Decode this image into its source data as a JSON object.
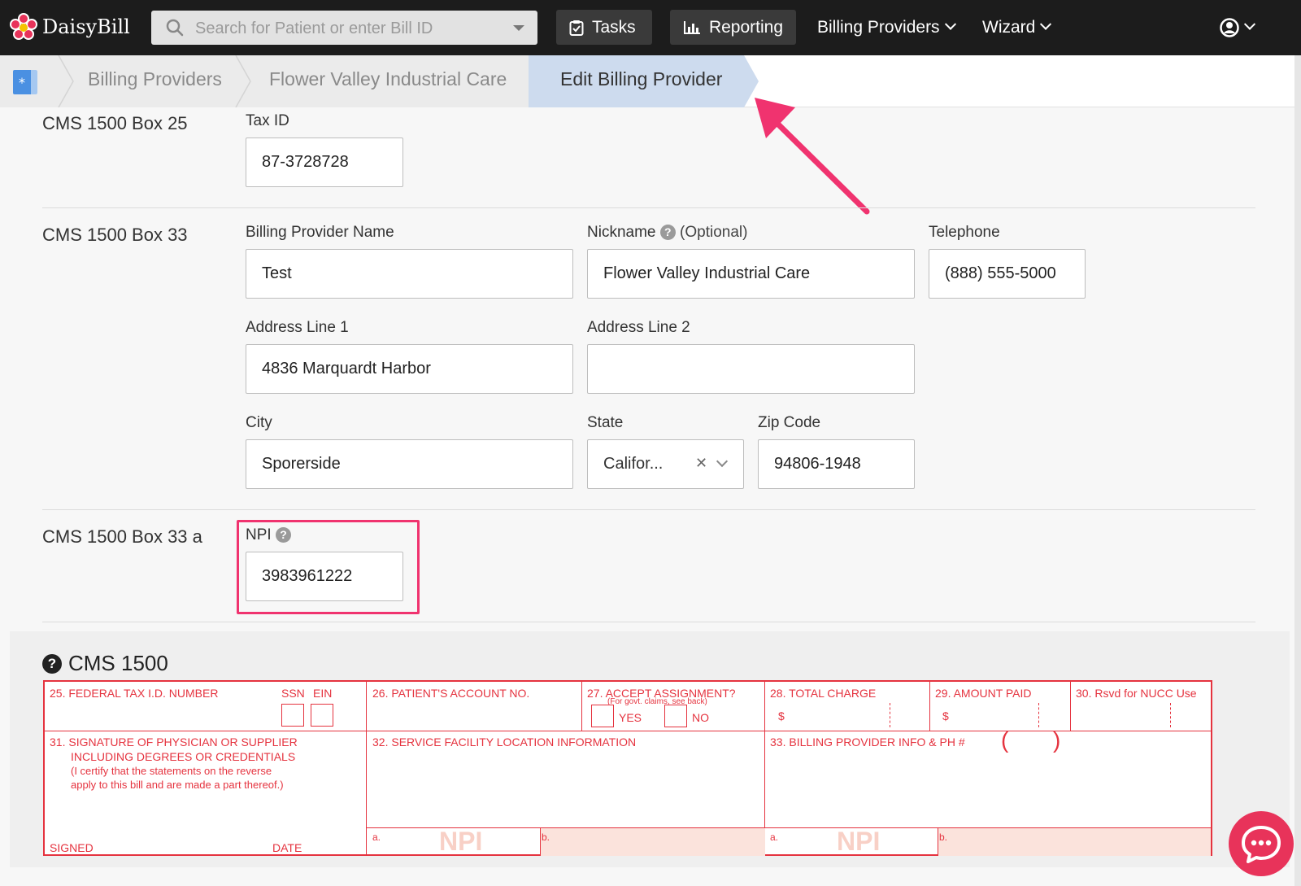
{
  "app": {
    "brand": "DaisyBill"
  },
  "search": {
    "placeholder": "Search for Patient or enter Bill ID"
  },
  "nav": {
    "tasks": "Tasks",
    "reporting": "Reporting",
    "billing_providers": "Billing Providers",
    "wizard": "Wizard"
  },
  "breadcrumb": {
    "items": [
      "Billing Providers",
      "Flower Valley Industrial Care"
    ],
    "active": "Edit Billing Provider"
  },
  "sections": {
    "box25": {
      "label": "CMS 1500 Box 25",
      "tax_id": {
        "label": "Tax ID",
        "value": "87-3728728"
      }
    },
    "box33": {
      "label": "CMS 1500 Box 33",
      "billing_provider_name": {
        "label": "Billing Provider Name",
        "value": "Test"
      },
      "nickname": {
        "label": "Nickname",
        "optional": "(Optional)",
        "value": "Flower Valley Industrial Care"
      },
      "telephone": {
        "label": "Telephone",
        "value": "(888) 555-5000"
      },
      "address1": {
        "label": "Address Line 1",
        "value": "4836 Marquardt Harbor"
      },
      "address2": {
        "label": "Address Line 2",
        "value": ""
      },
      "city": {
        "label": "City",
        "value": "Sporerside"
      },
      "state": {
        "label": "State",
        "value": "Califor..."
      },
      "zip": {
        "label": "Zip Code",
        "value": "94806-1948"
      }
    },
    "box33a": {
      "label": "CMS 1500 Box 33 a",
      "npi": {
        "label": "NPI",
        "value": "3983961222"
      }
    }
  },
  "cms1500": {
    "title": "CMS 1500",
    "f25": "25. FEDERAL TAX I.D. NUMBER",
    "ssn": "SSN",
    "ein": "EIN",
    "f26": "26. PATIENT'S ACCOUNT NO.",
    "f27": "27. ACCEPT ASSIGNMENT?",
    "f27_note": "(For govt. claims, see back)",
    "yes": "YES",
    "no": "NO",
    "f28": "28. TOTAL CHARGE",
    "f29": "29. AMOUNT PAID",
    "f30": "30. Rsvd for NUCC Use",
    "dollar": "$",
    "f31_1": "31. SIGNATURE OF PHYSICIAN OR SUPPLIER",
    "f31_2": "INCLUDING DEGREES OR CREDENTIALS",
    "f31_3": "(I certify that the statements on the reverse",
    "f31_4": "apply to this bill and are made a part thereof.)",
    "signed": "SIGNED",
    "date": "DATE",
    "f32": "32. SERVICE FACILITY LOCATION INFORMATION",
    "f33": "33. BILLING PROVIDER INFO & PH #",
    "paren_open": "(",
    "paren_close": ")",
    "a": "a.",
    "b": "b.",
    "npi": "NPI"
  },
  "colors": {
    "accent": "#f0336f",
    "form_red": "#e5333f",
    "topbar": "#1c1c1c"
  },
  "icons": [
    "daisy-logo-icon",
    "search-icon",
    "clipboard-icon",
    "bar-chart-icon",
    "user-circle-icon",
    "chat-icon",
    "help-icon"
  ]
}
